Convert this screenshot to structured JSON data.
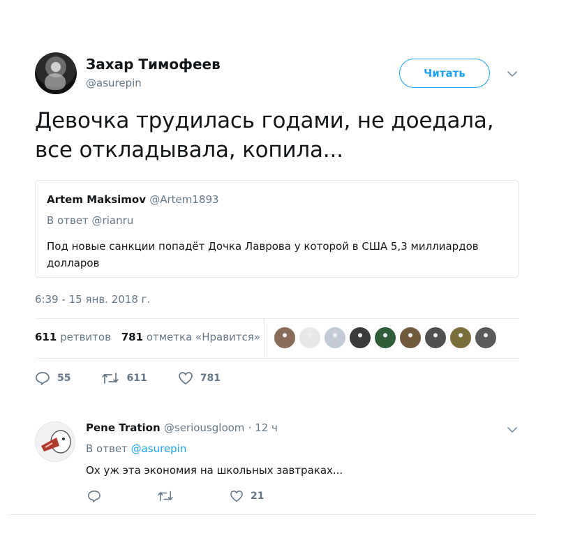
{
  "tweet": {
    "author_name": "Захар Тимофеев",
    "author_handle": "@asurepin",
    "follow_label": "Читать",
    "text": "Девочка трудилась годами, не доедала, все откладывала, копила...",
    "quote": {
      "name": "Artem Maksimov",
      "handle": "@Artem1893",
      "reply_to": "В ответ @rianru",
      "text": "Под новые санкции попадёт Дочка Лаврова у которой в США 5,3 миллиардов долларов"
    },
    "timestamp": "6:39 - 15 янв. 2018 г.",
    "stats": {
      "retweets_count": "611",
      "retweets_label": "ретвитов",
      "likes_count": "781",
      "likes_label": "отметка «Нравится»"
    },
    "liker_colors": [
      "#8a6b5a",
      "#e8e8e8",
      "#c3ccd6",
      "#3b3b3b",
      "#2f5d3a",
      "#6f5a3c",
      "#4f4f4f",
      "#7a6f3a",
      "#5a5a5a"
    ],
    "actions": {
      "replies": "55",
      "retweets": "611",
      "likes": "781"
    }
  },
  "reply": {
    "name": "Pene Tration",
    "handle": "@seriousgloom",
    "time": "· 12 ч",
    "reply_prefix": "В ответ",
    "reply_to": "@asurepin",
    "text": "Ох уж эта экономия на школьных завтраках...",
    "likes": "21"
  },
  "colors": {
    "accent": "#1da1f2",
    "muted": "#657786",
    "text": "#14171a"
  }
}
